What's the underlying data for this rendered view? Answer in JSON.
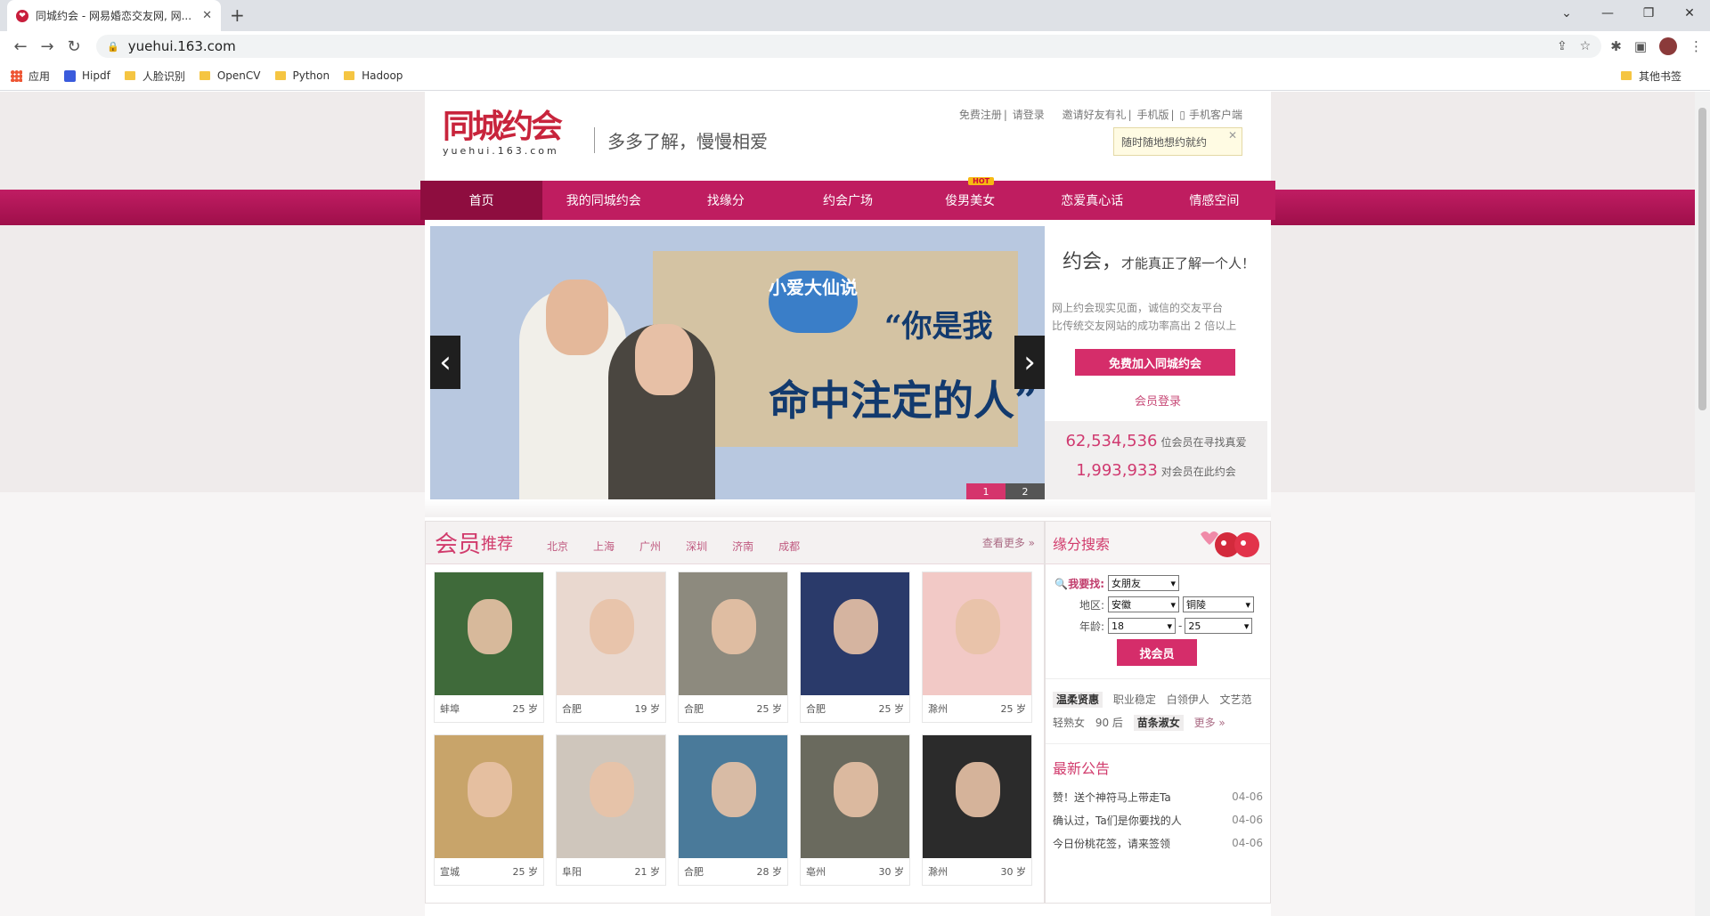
{
  "browser": {
    "tab_title": "同城约会 - 网易婚恋交友网, 网...",
    "url": "yuehui.163.com"
  },
  "bookmarks": [
    "应用",
    "Hipdf",
    "人脸识别",
    "OpenCV",
    "Python",
    "Hadoop"
  ],
  "bookmarks_right": "其他书签",
  "header": {
    "logo_cn": "同城约会",
    "logo_en": "yuehui.163.com",
    "slogan": "多多了解，慢慢相爱",
    "links": [
      "免费注册",
      "请登录",
      "邀请好友有礼",
      "手机版",
      "手机客户端"
    ],
    "tip": "随时随地想约就约"
  },
  "nav": [
    "首页",
    "我的同城约会",
    "找缘分",
    "约会广场",
    "俊男美女",
    "恋爱真心话",
    "情感空间"
  ],
  "nav_hot": "HOT",
  "banner": {
    "bubble": "小爱大仙说",
    "line1": "“你是我",
    "line2": "命中注定的人”",
    "page1": "1",
    "page2": "2"
  },
  "side": {
    "handwriting": "约会，",
    "handwriting_small": "才能真正了解一个人！",
    "desc1": "网上约会现实见面，诚信的交友平台",
    "desc2": "比传统交友网站的成功率高出 2 倍以上",
    "join": "免费加入同城约会",
    "login": "会员登录",
    "stat1_num": "62,534,536",
    "stat1_txt": "位会员在寻找真爱",
    "stat2_num": "1,993,933",
    "stat2_txt": "对会员在此约会"
  },
  "members": {
    "title": "会员",
    "title2": "推荐",
    "cities": [
      "北京",
      "上海",
      "广州",
      "深圳",
      "济南",
      "成都"
    ],
    "more": "查看更多 »",
    "cards": [
      {
        "city": "蚌埠",
        "age": "25 岁",
        "color": "#3f6a3a"
      },
      {
        "city": "合肥",
        "age": "19 岁",
        "color": "#e9d8cf"
      },
      {
        "city": "合肥",
        "age": "25 岁",
        "color": "#8d8a7e"
      },
      {
        "city": "合肥",
        "age": "25 岁",
        "color": "#2a3a6a"
      },
      {
        "city": "滁州",
        "age": "25 岁",
        "color": "#f2c9c6"
      },
      {
        "city": "宣城",
        "age": "25 岁",
        "color": "#c8a46a"
      },
      {
        "city": "阜阳",
        "age": "21 岁",
        "color": "#cfc6bc"
      },
      {
        "city": "合肥",
        "age": "28 岁",
        "color": "#4a7a9a"
      },
      {
        "city": "亳州",
        "age": "30 岁",
        "color": "#6a6a5e"
      },
      {
        "city": "滁州",
        "age": "30 岁",
        "color": "#2b2b2b"
      }
    ]
  },
  "search": {
    "title": "缘分搜索",
    "find_label": "我要找:",
    "find_val": "女朋友",
    "region_label": "地区:",
    "prov": "安徽",
    "cityv": "铜陵",
    "age_label": "年龄:",
    "age_from": "18",
    "dash": "-",
    "age_to": "25",
    "btn": "找会员"
  },
  "tags": [
    "温柔贤惠",
    "职业稳定",
    "白领伊人",
    "文艺范",
    "轻熟女",
    "90 后",
    "苗条淑女"
  ],
  "tags_more": "更多 »",
  "notice": {
    "title": "最新公告",
    "items": [
      {
        "t": "赞！送个神符马上带走Ta",
        "d": "04-06"
      },
      {
        "t": "确认过，Ta们是你要找的人",
        "d": "04-06"
      },
      {
        "t": "今日份桃花签，请来签领",
        "d": "04-06"
      }
    ]
  }
}
